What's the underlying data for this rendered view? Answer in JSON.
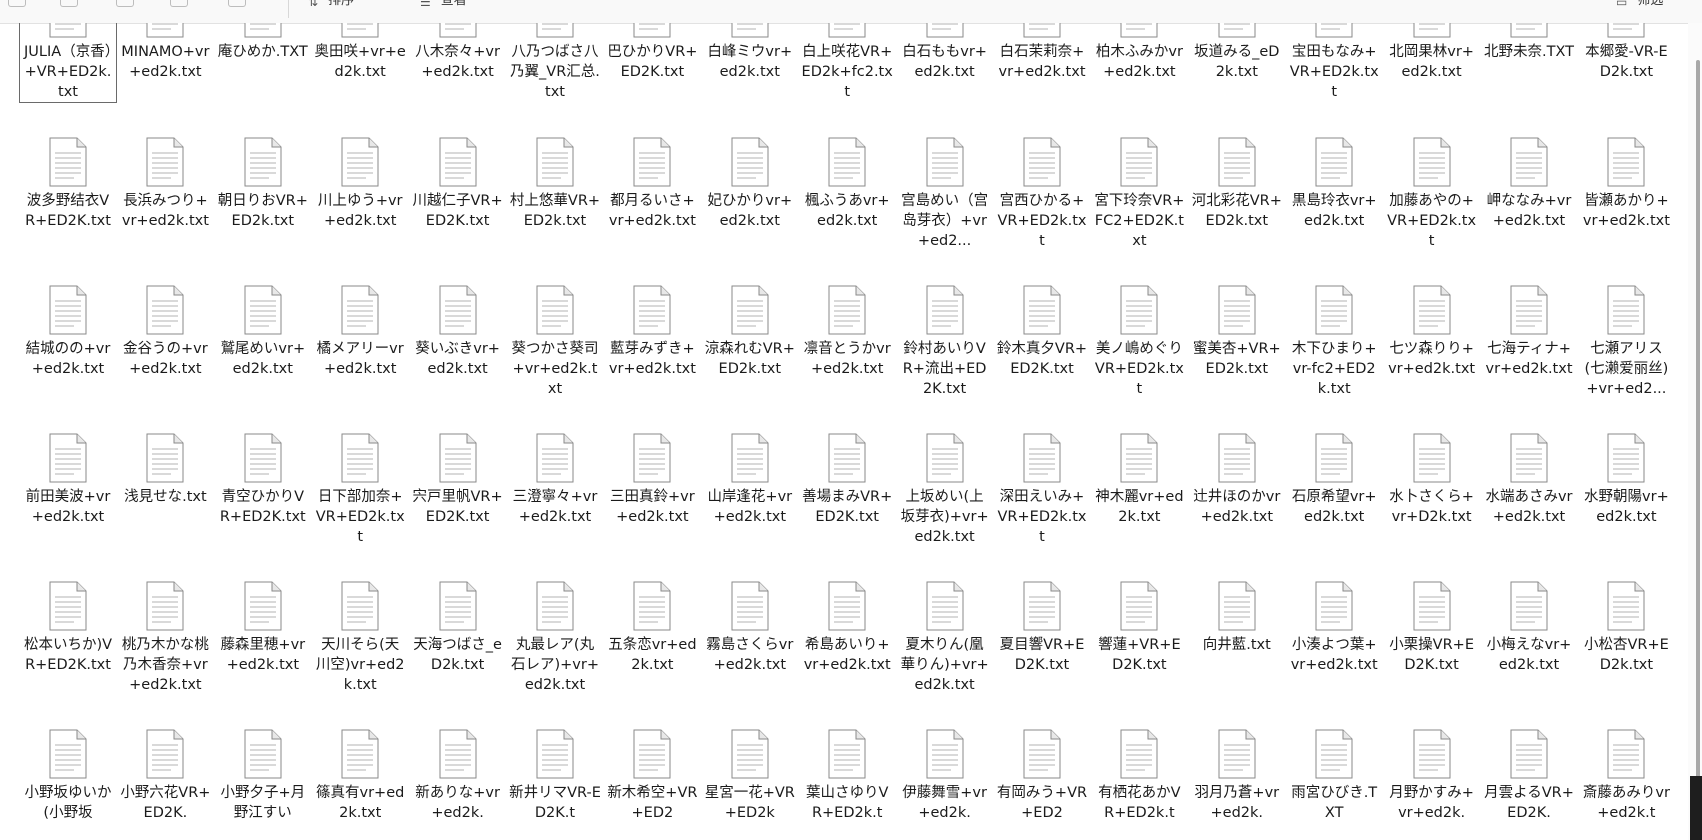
{
  "toolbar": {
    "items": [
      {
        "icon": "sort-icon",
        "label": "排序"
      },
      {
        "icon": "view-icon",
        "label": "查看"
      }
    ],
    "right_label": "筛选"
  },
  "files": [
    "JULIA（京香）+VR+ED2k.txt",
    "MINAMO+vr+ed2k.txt",
    "庵ひめか.TXT",
    "奥田咲+vr+ed2k.txt",
    "八木奈々+vr+ed2k.txt",
    "八乃つばさ八乃翼_VR汇总.txt",
    "巴ひかりVR+ED2K.txt",
    "白峰ミウvr+ed2k.txt",
    "白上咲花VR+ED2k+fc2.txt",
    "白石ももvr+ed2k.txt",
    "白石茉莉奈+vr+ed2k.txt",
    "柏木ふみかvr+ed2k.txt",
    "坂道みる_eD2k.txt",
    "宝田もなみ+VR+ED2k.txt",
    "北岡果林vr+ed2k.txt",
    "北野未奈.TXT",
    "本郷愛-VR-ED2k.txt",
    "波多野结衣VR+ED2K.txt",
    "長浜みつり+vr+ed2k.txt",
    "朝日りおVR+ED2k.txt",
    "川上ゆう+vr+ed2k.txt",
    "川越仁子VR+ED2K.txt",
    "村上悠華VR+ED2k.txt",
    "都月るいさ+vr+ed2k.txt",
    "妃ひかりvr+ed2k.txt",
    "楓ふうあvr+ed2k.txt",
    "宫島めい（宫岛芽衣）+vr+ed2...",
    "宫西ひかる+VR+ED2k.txt",
    "宮下玲奈VR+FC2+ED2K.txt",
    "河北彩花VR+ED2k.txt",
    "黒島玲衣vr+ed2k.txt",
    "加藤あやの+VR+ED2k.txt",
    "岬ななみ+vr+ed2k.txt",
    "皆瀬あかり+vr+ed2k.txt",
    "結城のの+vr+ed2k.txt",
    "金谷うの+vr+ed2k.txt",
    "鷲尾めいvr+ed2k.txt",
    "橘メアリーvr+ed2k.txt",
    "葵いぶきvr+ed2k.txt",
    "葵つかさ葵司+vr+ed2k.txt",
    "藍芽みずき+vr+ed2k.txt",
    "涼森れむVR+ED2k.txt",
    "凛音とうかvr+ed2k.txt",
    "鈴村あいりVR+流出+ED2K.txt",
    "鈴木真夕VR+ED2K.txt",
    "美ノ嶋めぐりVR+ED2k.txt",
    "蜜美杏+VR+ED2k.txt",
    "木下ひまり+vr-fc2+ED2k.txt",
    "七ツ森りり+vr+ed2k.txt",
    "七海ティナ+vr+ed2k.txt",
    "七瀬アリス(七濑爱丽丝)+vr+ed2...",
    "前田美波+vr+ed2k.txt",
    "浅見せな.txt",
    "青空ひかりVR+ED2K.txt",
    "日下部加奈+VR+ED2k.txt",
    "宍戸里帆VR+ED2K.txt",
    "三澄寧々+vr+ed2k.txt",
    "三田真鈴+vr+ed2k.txt",
    "山岸逢花+vr+ed2k.txt",
    "善場まみVR+ED2K.txt",
    "上坂めい(上坂芽衣)+vr+ed2k.txt",
    "深田えいみ+VR+ED2k.txt",
    "神木麗vr+ed2k.txt",
    "辻井ほのかvr+ed2k.txt",
    "石原希望vr+ed2k.txt",
    "水卜さくら+vr+D2k.txt",
    "水端あさみvr+ed2k.txt",
    "水野朝陽vr+ed2k.txt",
    "松本いちか)VR+ED2K.txt",
    "桃乃木かな桃乃木香奈+vr+ed2k.txt",
    "藤森里穂+vr+ed2k.txt",
    "天川そら(天川空)vr+ed2k.txt",
    "天海つばさ_eD2k.txt",
    "丸最レア(丸石レア)+vr+ed2k.txt",
    "五条恋vr+ed2k.txt",
    "霧島さくらvr+ed2k.txt",
    "希島あいり+vr+ed2k.txt",
    "夏木りん(凰華りん)+vr+ed2k.txt",
    "夏目響VR+ED2K.txt",
    "響蓮+VR+ED2K.txt",
    "向井藍.txt",
    "小湊よつ葉+vr+ed2k.txt",
    "小栗操VR+ED2K.txt",
    "小梅えなvr+ed2k.txt",
    "小松杏VR+ED2k.txt",
    "小野坂ゆいか(小野坂",
    "小野六花VR+ED2K.",
    "小野夕子+月野江すい",
    "篠真有vr+ed2k.txt",
    "新ありな+vr+ed2k.",
    "新井リマVR-ED2K.t",
    "新木希空+VR+ED2",
    "星宮一花+VR+ED2k",
    "葉山さゆりVR+ED2k.t",
    "伊藤舞雪+vr+ed2k.",
    "有岡みう+VR+ED2",
    "有栖花あかVR+ED2k.t",
    "羽月乃蒼+vr+ed2k.",
    "雨宮ひびき.TXT",
    "月野かすみ+vr+ed2k.",
    "月雲よるVR+ED2K.",
    "斎藤あみりvr+ed2k.t"
  ]
}
